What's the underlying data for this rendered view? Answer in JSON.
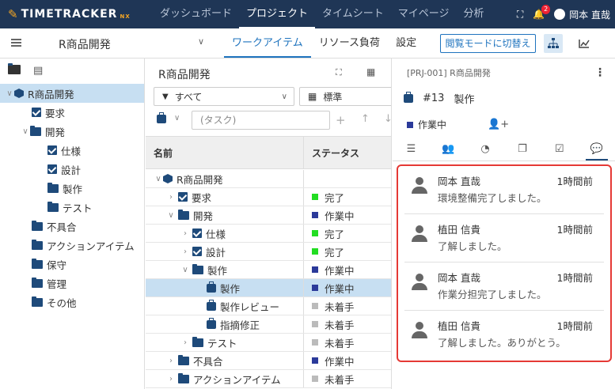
{
  "app": {
    "logo": "TIMETRACKER",
    "logo_sub": "NX"
  },
  "nav": [
    "ダッシュボード",
    "プロジェクト",
    "タイムシート",
    "マイページ",
    "分析"
  ],
  "notifications": "2",
  "user": "岡本 直哉",
  "project": {
    "title": "R商品開発"
  },
  "tabs": [
    "ワークアイテム",
    "リソース負荷",
    "設定"
  ],
  "view_button": "閲覧モードに切替え",
  "left_tree": [
    {
      "label": "R商品開発"
    },
    {
      "label": "要求"
    },
    {
      "label": "開発"
    },
    {
      "label": "仕様"
    },
    {
      "label": "設計"
    },
    {
      "label": "製作"
    },
    {
      "label": "テスト"
    },
    {
      "label": "不具合"
    },
    {
      "label": "アクションアイテム"
    },
    {
      "label": "保守"
    },
    {
      "label": "管理"
    },
    {
      "label": "その他"
    }
  ],
  "middle": {
    "title": "R商品開発",
    "filter": "すべて",
    "view": "標準",
    "task_placeholder": "(タスク)",
    "col_name": "名前",
    "col_status": "ステータス",
    "rows": [
      {
        "name": "R商品開発",
        "status": ""
      },
      {
        "name": "要求",
        "status": "完了"
      },
      {
        "name": "開発",
        "status": "作業中"
      },
      {
        "name": "仕様",
        "status": "完了"
      },
      {
        "name": "設計",
        "status": "完了"
      },
      {
        "name": "製作",
        "status": "作業中"
      },
      {
        "name": "製作",
        "status": "作業中"
      },
      {
        "name": "製作レビュー",
        "status": "未着手"
      },
      {
        "name": "指摘修正",
        "status": "未着手"
      },
      {
        "name": "テスト",
        "status": "未着手"
      },
      {
        "name": "不具合",
        "status": "作業中"
      },
      {
        "name": "アクションアイテム",
        "status": "未着手"
      }
    ]
  },
  "status_colors": {
    "done": "#22dd22",
    "doing": "#2b3a9a",
    "todo": "#bbbbbb"
  },
  "detail": {
    "header": "[PRJ-001] R商品開発",
    "id": "#13",
    "name": "製作",
    "status": "作業中"
  },
  "comments": [
    {
      "name": "岡本 直哉",
      "time": "1時間前",
      "text": "環境整備完了しました。"
    },
    {
      "name": "植田 信貴",
      "time": "1時間前",
      "text": "了解しました。"
    },
    {
      "name": "岡本 直哉",
      "time": "1時間前",
      "text": "作業分担完了しました。"
    },
    {
      "name": "植田 信貴",
      "time": "1時間前",
      "text": "了解しました。ありがとう。"
    }
  ]
}
